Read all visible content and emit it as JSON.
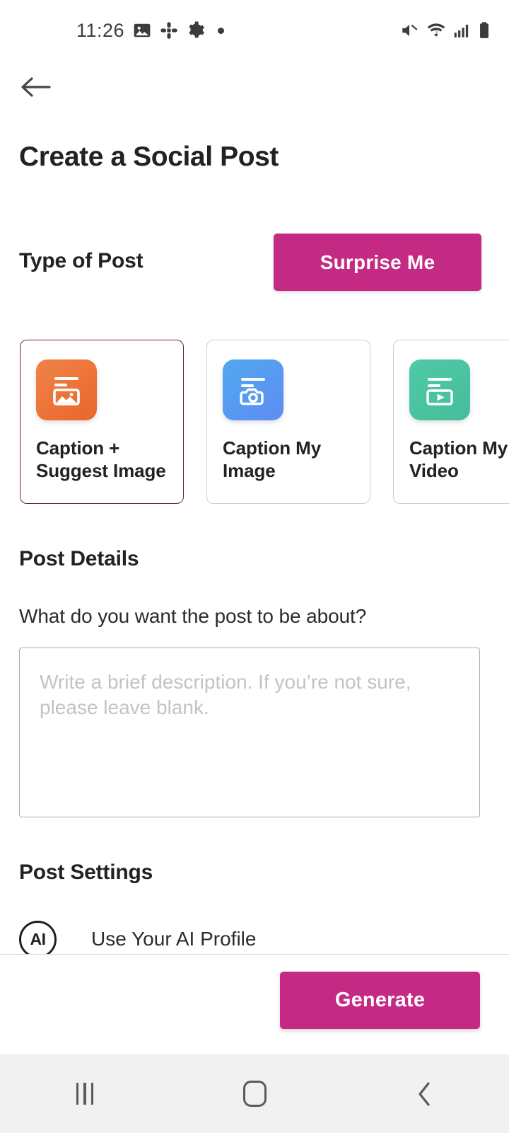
{
  "statusbar": {
    "time": "11:26",
    "left_icons": [
      "image-icon",
      "slack-icon",
      "gear-icon",
      "dot-icon"
    ],
    "right_icons": [
      "mute-icon",
      "wifi-icon",
      "cellular-signal-icon",
      "battery-icon"
    ]
  },
  "nav": {
    "back_icon": "back-arrow-icon"
  },
  "header": {
    "title": "Create a Social Post"
  },
  "type_of_post": {
    "label": "Type of Post",
    "surprise_label": "Surprise Me",
    "cards": [
      {
        "label": "Caption +\nSuggest Image",
        "icon": "image-document-icon",
        "color": "#ea6a2f",
        "selected": true
      },
      {
        "label": "Caption My\nImage",
        "icon": "camera-document-icon",
        "color": "#55a0f0",
        "selected": false
      },
      {
        "label": "Caption My\nVideo",
        "icon": "video-document-icon",
        "color": "#4bc4a0",
        "selected": false
      }
    ]
  },
  "post_details": {
    "title": "Post Details",
    "question": "What do you want the post to be about?",
    "description_value": "",
    "description_placeholder": "Write a brief description. If you’re not sure, please leave blank."
  },
  "post_settings": {
    "title": "Post Settings",
    "ai_profile": {
      "badge": "AI",
      "label": "Use Your AI Profile"
    }
  },
  "footer": {
    "generate_label": "Generate"
  },
  "system_nav": {
    "recents": "recents-icon",
    "home": "home-icon",
    "back": "back-icon"
  },
  "colors": {
    "accent": "#c42a84",
    "selected_border": "#6d2342",
    "text": "#222226",
    "placeholder": "#c3c3c3"
  }
}
